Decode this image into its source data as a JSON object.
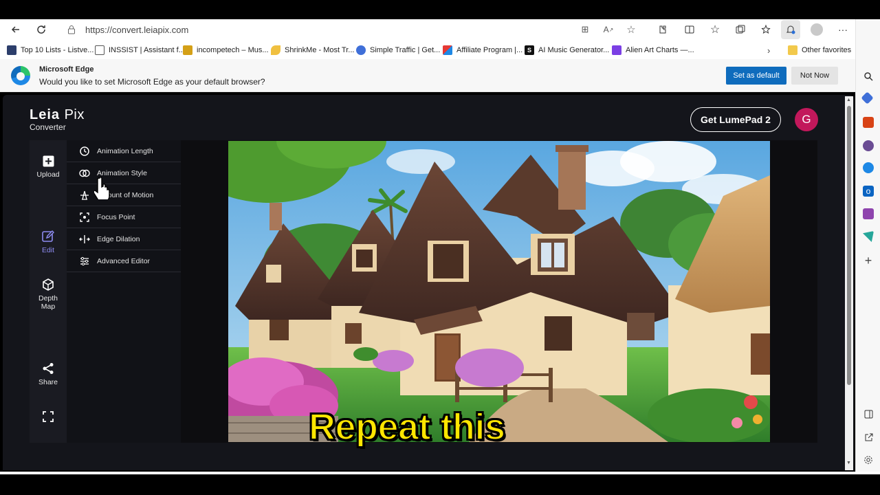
{
  "browser": {
    "url": "https://convert.leiapix.com",
    "bookmarks": [
      "Top 10 Lists - Listve...",
      "INSSIST | Assistant f...",
      "incompetech – Mus...",
      "ShrinkMe - Most Tr...",
      "Simple Traffic | Get...",
      "Affiliate Program |...",
      "AI Music Generator...",
      "Alien Art Charts —..."
    ],
    "other_favorites": "Other favorites",
    "infobar": {
      "title": "Microsoft Edge",
      "message": "Would you like to set Microsoft Edge as your default browser?",
      "set_default": "Set as default",
      "not_now": "Not Now"
    }
  },
  "app": {
    "logo_main": "Leia",
    "logo_pix": "Pix",
    "logo_sub": "Converter",
    "cta": "Get LumePad 2",
    "avatar_initial": "G",
    "rail": {
      "upload": "Upload",
      "edit": "Edit",
      "depth_map_1": "Depth",
      "depth_map_2": "Map",
      "share": "Share"
    },
    "edit_menu": [
      "Animation Length",
      "Animation Style",
      "Amount of Motion",
      "Focus Point",
      "Edge Dilation",
      "Advanced Editor"
    ]
  },
  "video_caption": "Repeat this",
  "colors": {
    "accent": "#8e8cf2",
    "edge_blue": "#0f6cbd",
    "avatar": "#c2185b",
    "caption": "#ffe600"
  }
}
